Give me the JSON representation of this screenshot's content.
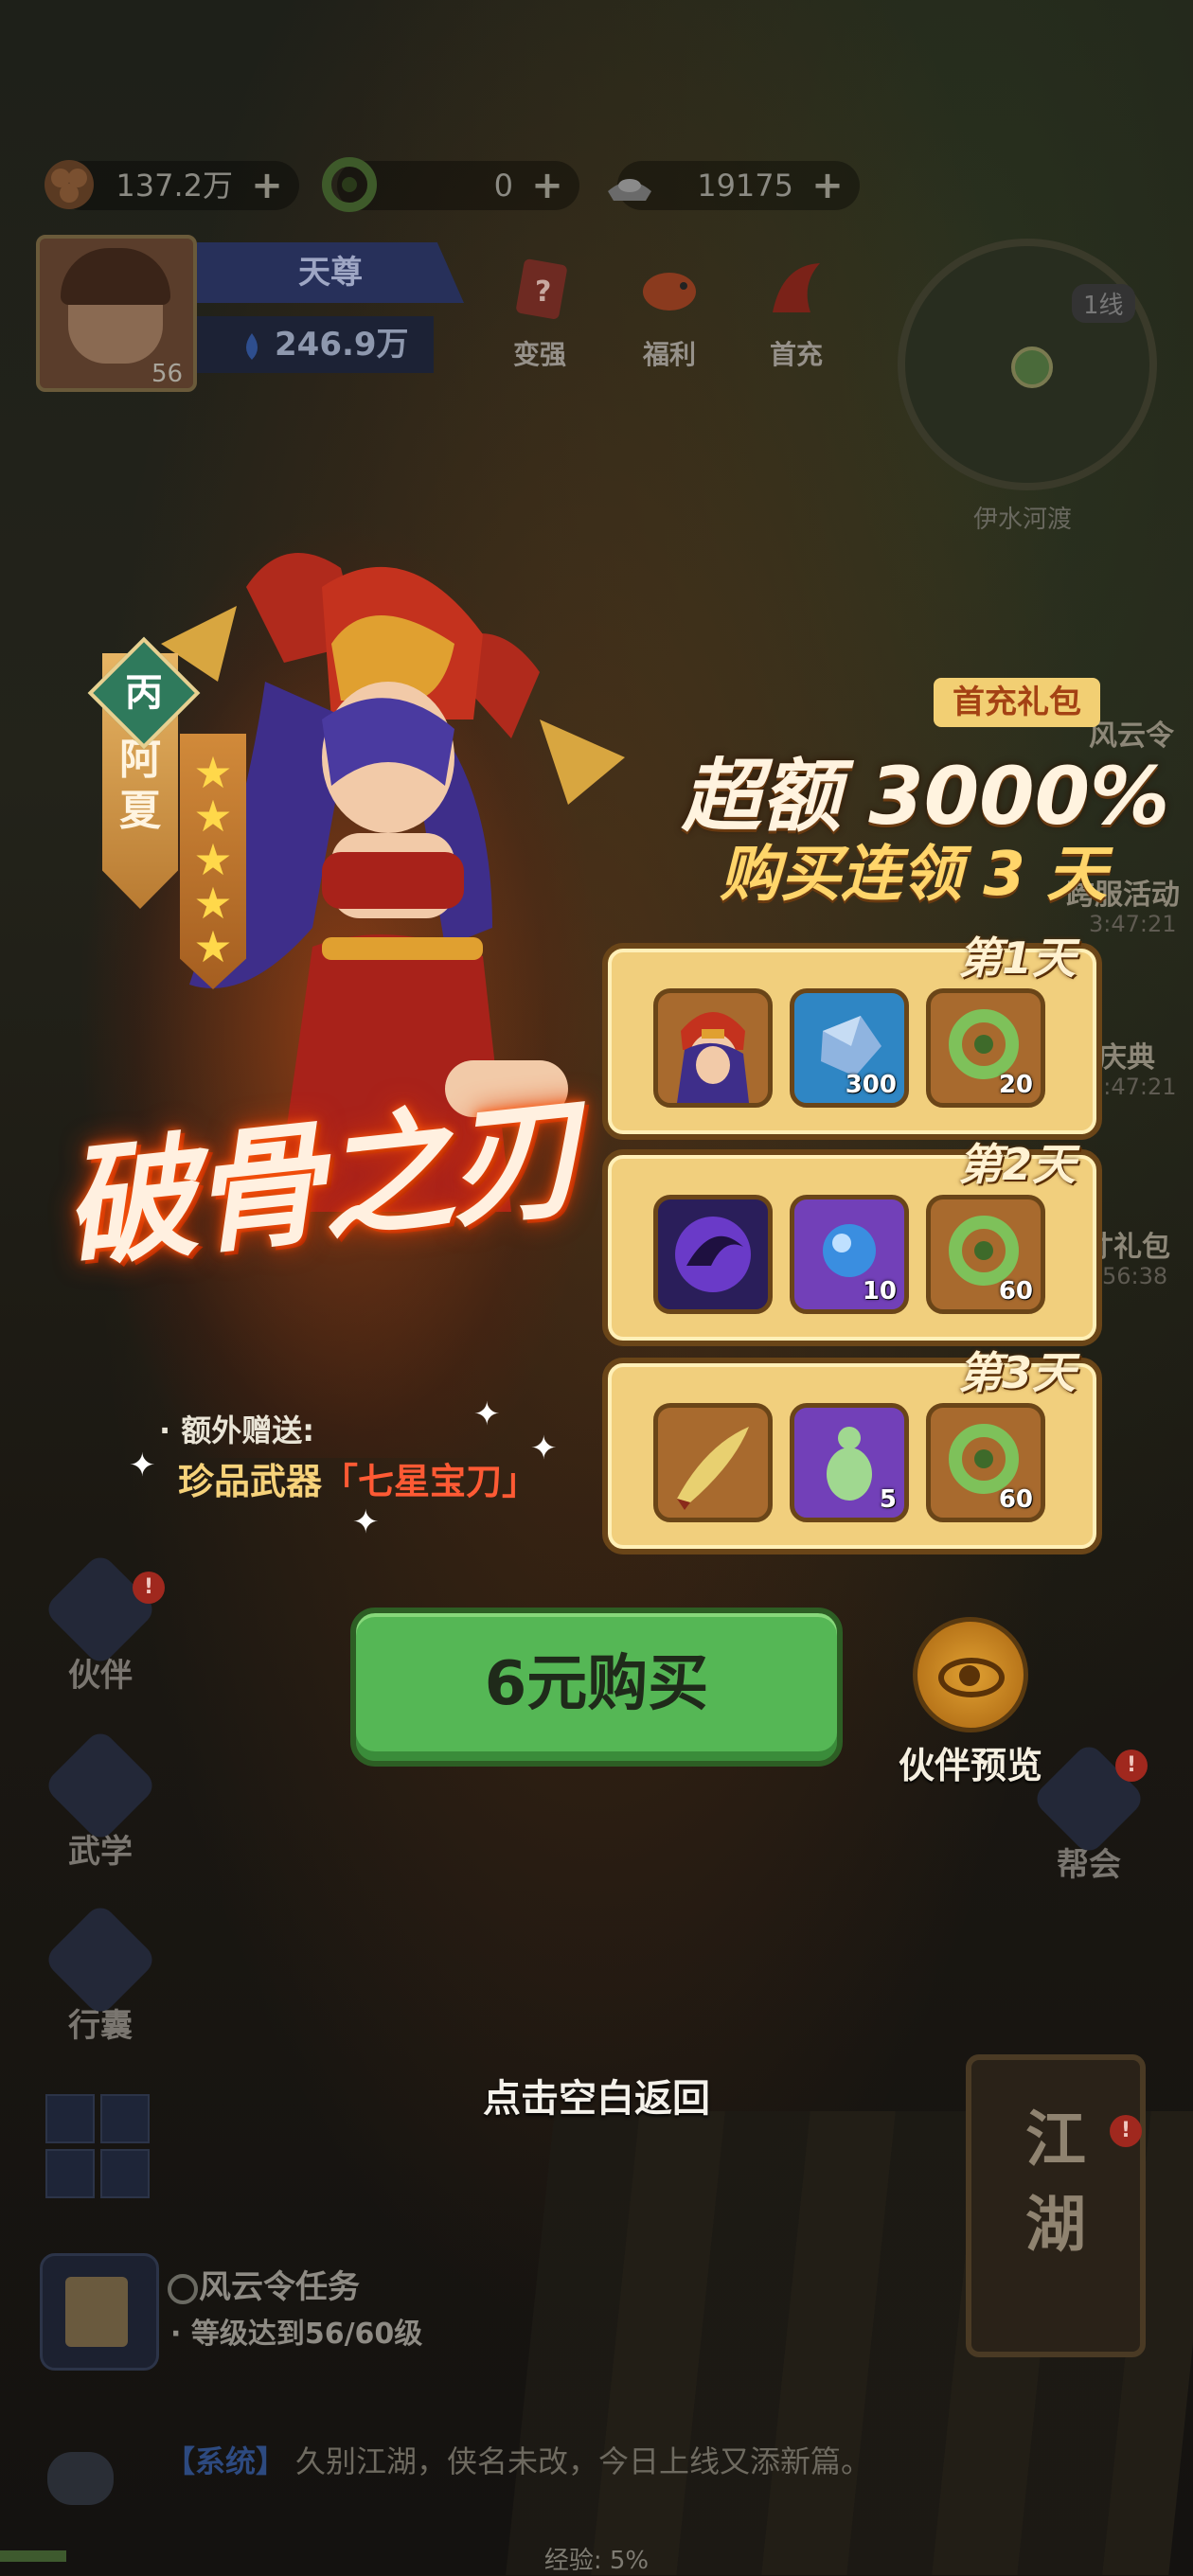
{
  "currency": [
    {
      "icon": "copper-coin-icon",
      "value": "137.2万"
    },
    {
      "icon": "jade-ring-icon",
      "value": "0"
    },
    {
      "icon": "silver-ingot-icon",
      "value": "19175"
    }
  ],
  "player": {
    "level": "56",
    "title": "天尊",
    "power": "246.9万"
  },
  "top_menu": [
    {
      "label": "变强",
      "icon": "upgrade-book-icon"
    },
    {
      "label": "福利",
      "icon": "gift-fish-icon"
    },
    {
      "label": "首充",
      "icon": "first-charge-icon"
    }
  ],
  "minimap": {
    "line": "1线",
    "location": "伊水河渡"
  },
  "side_events": [
    {
      "label": "风云令"
    },
    {
      "label": "跨服活动",
      "time": "3:47:21"
    },
    {
      "label": "庆典",
      "time": "3:47:21"
    },
    {
      "label": "寸礼包",
      "time": "56:38"
    }
  ],
  "left_nav": [
    {
      "label": "伙伴",
      "badge": "!"
    },
    {
      "label": "武学"
    },
    {
      "label": "行囊"
    }
  ],
  "right_nav": {
    "label": "帮会",
    "badge": "!"
  },
  "jianghu": {
    "line1": "江",
    "line2": "湖",
    "badge": "!"
  },
  "task": {
    "title": "风云令任务",
    "desc": "· 等级达到56/60级"
  },
  "system_msg": {
    "tag": "【系统】",
    "text": "久别江湖，侠名未改，今日上线又添新篇。"
  },
  "exp": {
    "label": "经验: 5%",
    "percent": 5
  },
  "popup": {
    "hero": {
      "grade": "丙",
      "name_1": "阿",
      "name_2": "夏",
      "stars": 5
    },
    "skill_name": "破骨之刃",
    "bonus_line1": "· 额外赠送:",
    "bonus_prefix": "珍品武器",
    "bonus_item": "「七星宝刀」",
    "badge": "首充礼包",
    "promo_line1": "超额 3000%",
    "promo_line2": "购买连领 3 天",
    "days": [
      {
        "label": "第1天",
        "items": [
          {
            "icon": "hero-portrait-icon",
            "qty": ""
          },
          {
            "icon": "blue-crystal-icon",
            "qty": "300"
          },
          {
            "icon": "jade-ring-icon",
            "qty": "20"
          }
        ]
      },
      {
        "label": "第2天",
        "items": [
          {
            "icon": "purple-swirl-icon",
            "qty": ""
          },
          {
            "icon": "spirit-orb-icon",
            "qty": "10"
          },
          {
            "icon": "jade-ring-icon",
            "qty": "60"
          }
        ]
      },
      {
        "label": "第3天",
        "items": [
          {
            "icon": "seven-star-blade-icon",
            "qty": ""
          },
          {
            "icon": "green-gourd-icon",
            "qty": "5"
          },
          {
            "icon": "jade-ring-icon",
            "qty": "60"
          }
        ]
      }
    ],
    "buy_label": "6元购买",
    "preview_label": "伙伴预览",
    "back_hint": "点击空白返回"
  }
}
